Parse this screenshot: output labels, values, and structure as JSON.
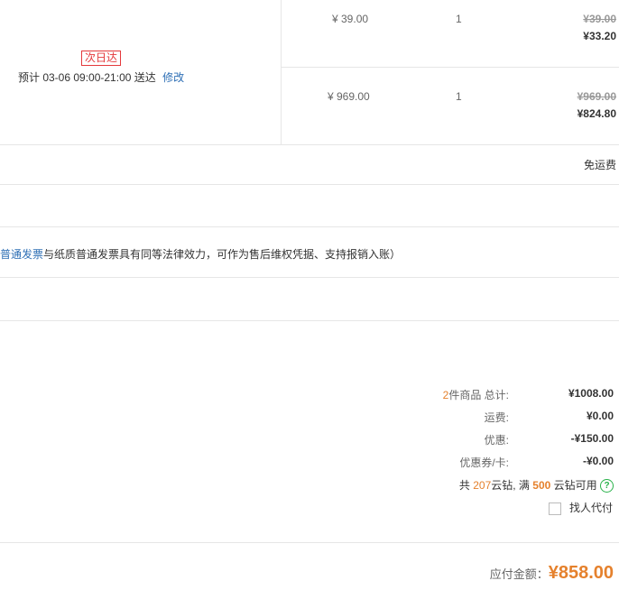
{
  "delivery": {
    "badge": "次日达",
    "estimate": "预计 03-06 09:00-21:00  送达",
    "modify_link": "修改"
  },
  "items": [
    {
      "unit_price": "¥ 39.00",
      "qty": "1",
      "orig_price": "¥39.00",
      "final_price": "¥33.20"
    },
    {
      "unit_price": "¥ 969.00",
      "qty": "1",
      "orig_price": "¥969.00",
      "final_price": "¥824.80"
    }
  ],
  "shipping_note": "免运费",
  "invoice": {
    "link": "普通发票",
    "text": "与纸质普通发票具有同等法律效力，可作为售后维权凭据、支持报销入账）"
  },
  "summary": {
    "count": "2",
    "count_suffix": "件商品  总计:",
    "total": "¥1008.00",
    "freight_label": "运费:",
    "freight": "¥0.00",
    "discount_label": "优惠:",
    "discount": "-¥150.00",
    "coupon_label": "优惠券/卡:",
    "coupon": "-¥0.00",
    "coin_prefix": "共 ",
    "coin_count": "207",
    "coin_mid": "云钻, 满 ",
    "coin_threshold": "500",
    "coin_suffix": " 云钻可用",
    "help_glyph": "?",
    "proxy_pay": "找人代付"
  },
  "payable": {
    "label": "应付金额：",
    "amount": "¥858.00"
  },
  "colors": {
    "accent": "#e5812d",
    "link": "#2e6fb5",
    "badge": "#e4393c",
    "help": "#2ab24b"
  }
}
